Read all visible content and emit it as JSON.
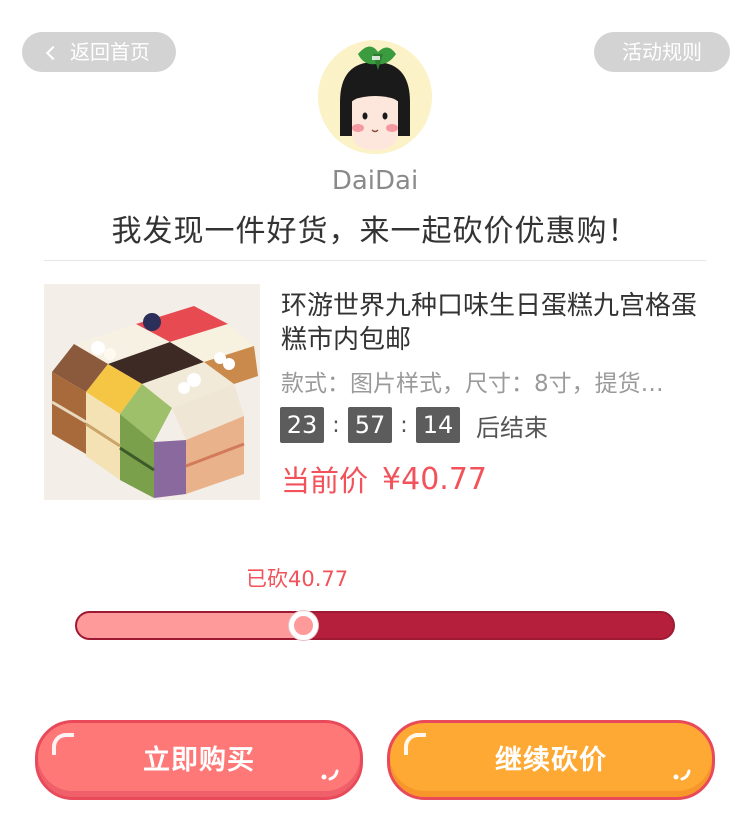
{
  "header": {
    "back_label": "返回首页",
    "rules_label": "活动规则"
  },
  "user": {
    "name": "DaiDai",
    "avatar_icon": "cartoon-avatar"
  },
  "slogan": "我发现一件好货，来一起砍价优惠购！",
  "product": {
    "title": "环游世界九种口味生日蛋糕九宫格蛋糕市内包邮",
    "spec": "款式：图片样式，尺寸：8寸，提货…",
    "countdown": {
      "hours": "23",
      "minutes": "57",
      "seconds": "14",
      "separator": ":",
      "suffix": "后结束"
    },
    "price_label": "当前价",
    "price_value": "¥40.77"
  },
  "bargain": {
    "tip": "已砍40.77",
    "progress_fraction": 0.38
  },
  "actions": {
    "buy_label": "立即购买",
    "bargain_label": "继续砍价"
  },
  "colors": {
    "accent_red": "#f2525a",
    "progress_track": "#b61f3c",
    "progress_fill": "#ff9a9b",
    "buy_button": "#ff7878",
    "bargain_button": "#ffa935"
  }
}
